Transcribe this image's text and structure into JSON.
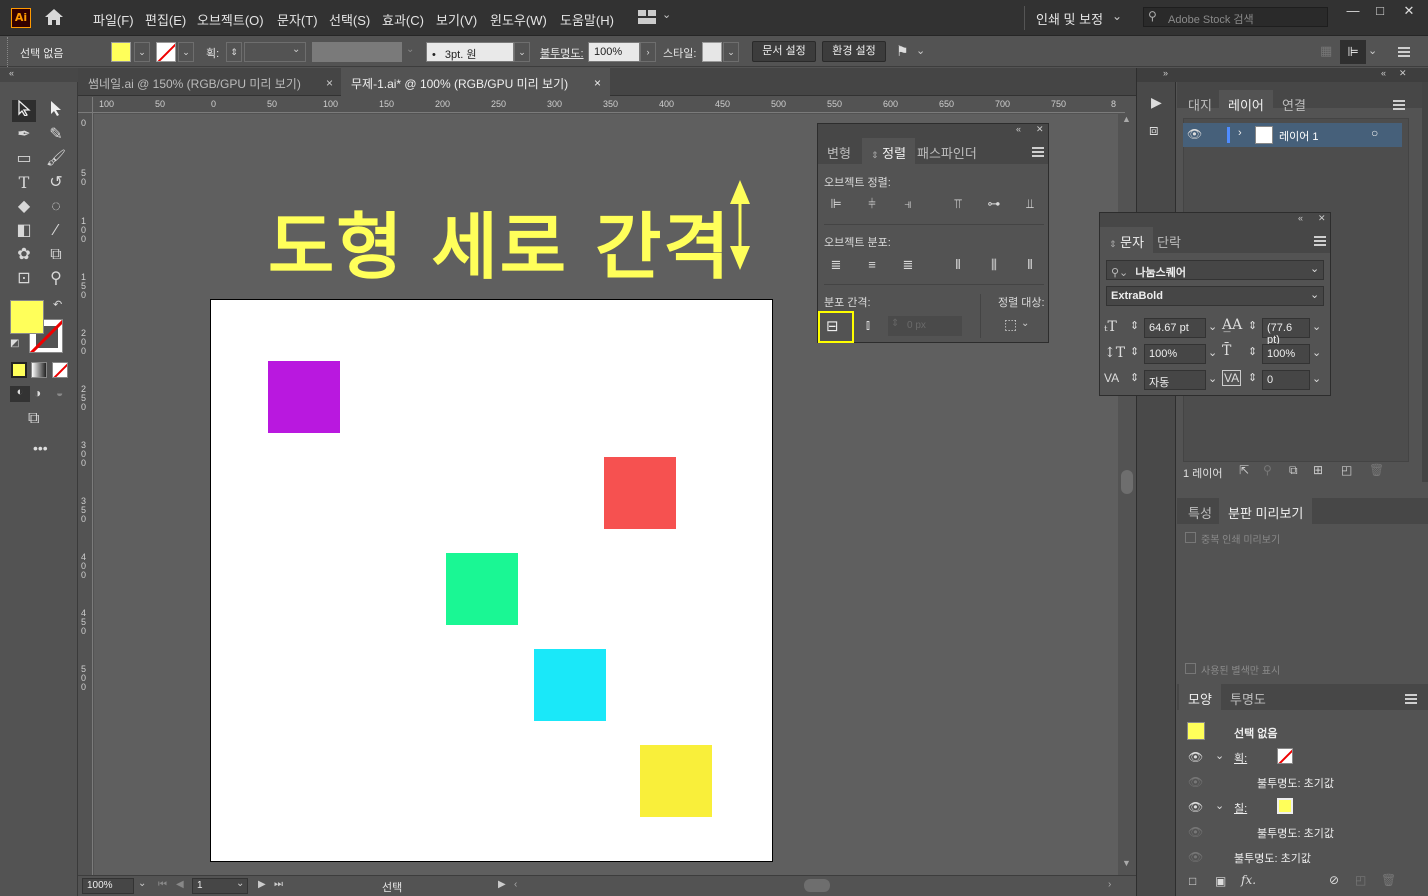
{
  "menubar": {
    "logo": "Ai",
    "items": [
      "파일(F)",
      "편집(E)",
      "오브젝트(O)",
      "문자(T)",
      "선택(S)",
      "효과(C)",
      "보기(V)",
      "윈도우(W)",
      "도움말(H)"
    ],
    "workspace": "인쇄 및 보정",
    "search_placeholder": "Adobe Stock 검색"
  },
  "controlbar": {
    "selection_status": "선택 없음",
    "stroke_label": "획:",
    "brush": "3pt. 원",
    "opacity_label": "불투명도:",
    "opacity_value": "100%",
    "style_label": "스타일:",
    "doc_setup_button": "문서 설정",
    "preferences_button": "환경 설정"
  },
  "tabs": [
    {
      "label": "썸네일.ai @ 150% (RGB/GPU 미리 보기)",
      "close": "×"
    },
    {
      "label": "무제-1.ai* @ 100% (RGB/GPU 미리 보기)",
      "close": "×"
    }
  ],
  "ruler": {
    "top_ticks": [
      "100",
      "50",
      "0",
      "50",
      "100",
      "150",
      "200",
      "250",
      "300",
      "350",
      "400",
      "450",
      "500",
      "550",
      "600",
      "650",
      "700",
      "750",
      "8"
    ],
    "left_ticks": [
      "0",
      "5 0",
      "1 0 0",
      "1 5 0",
      "2 0 0",
      "2 5 0",
      "3 0 0",
      "3 5 0",
      "4 0 0",
      "4 5 0",
      "5 0 0"
    ]
  },
  "canvas": {
    "headline": "도형 세로 간격",
    "colors": {
      "purple": "#b918df",
      "red": "#f65150",
      "green": "#1af794",
      "cyan": "#1ae8f9",
      "yellow": "#f9ef3a",
      "headline": "#ffff5a",
      "highlight": "#ffff00"
    }
  },
  "statusbar": {
    "zoom": "100%",
    "page": "1",
    "mode": "선택"
  },
  "align_panel": {
    "tabs": [
      "변형",
      "정렬",
      "패스파인더"
    ],
    "object_align_label": "오브젝트 정렬:",
    "object_distribute_label": "오브젝트 분포:",
    "distribute_spacing_label": "분포 간격:",
    "align_to_label": "정렬 대상:",
    "spacing_value": "0 px"
  },
  "char_panel": {
    "tabs": [
      "문자",
      "단락"
    ],
    "font_family": "나눔스퀘어",
    "font_style": "ExtraBold",
    "font_size": "64.67 pt",
    "leading": "(77.6 pt)",
    "vertical_scale": "100%",
    "horizontal_scale": "100%",
    "kerning": "자동",
    "tracking": "0"
  },
  "layers_panel": {
    "tabs": [
      "대지",
      "레이어",
      "연결"
    ],
    "layer_name": "레이어 1",
    "footer_count": "1 레이어"
  },
  "separations_panel": {
    "tabs": [
      "특성",
      "분판 미리보기"
    ],
    "overprint_label": "중복 인쇄 미리보기",
    "used_spot_label": "사용된 별색만 표시"
  },
  "appearance_panel": {
    "tabs": [
      "모양",
      "투명도"
    ],
    "title": "선택 없음",
    "stroke_label": "획:",
    "stroke_opacity": "불투명도: 초기값",
    "fill_label": "칠:",
    "fill_opacity": "불투명도: 초기값",
    "overall_opacity": "불투명도: 초기값",
    "fx_label": "fx."
  }
}
